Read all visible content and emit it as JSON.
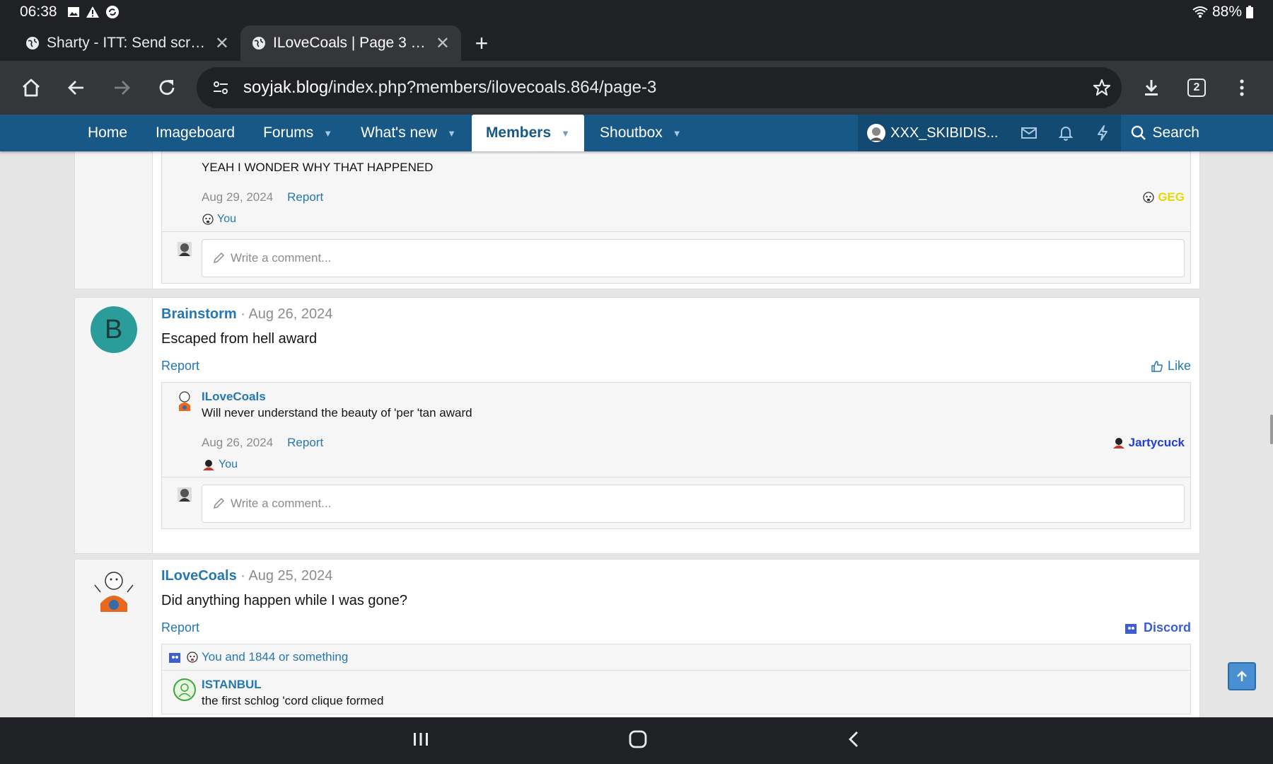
{
  "status_bar": {
    "time": "06:38",
    "battery": "88%"
  },
  "tabs": [
    {
      "title": "Sharty - ITT: Send screen",
      "active": false
    },
    {
      "title": "ILoveCoals | Page 3 | soyjak.blog",
      "active": true
    }
  ],
  "toolbar": {
    "tab_count": "2"
  },
  "omnibox": {
    "url_domain": "soyjak.blog",
    "url_path": "/index.php?members/ilovecoals.864/page-3"
  },
  "site_nav": {
    "items": [
      {
        "label": "Home",
        "caret": false
      },
      {
        "label": "Imageboard",
        "caret": false
      },
      {
        "label": "Forums",
        "caret": true
      },
      {
        "label": "What's new",
        "caret": true
      },
      {
        "label": "Members",
        "caret": true,
        "active": true
      },
      {
        "label": "Shoutbox",
        "caret": true
      }
    ],
    "user": "XXX_SKIBIDIS...",
    "search_label": "Search"
  },
  "post0": {
    "comment": {
      "text": "YEAH I WONDER WHY THAT HAPPENED",
      "date": "Aug 29, 2024",
      "report": "Report",
      "reaction": "GEG",
      "reaction_color": "#e6d800",
      "reacted_by": "You"
    },
    "comment_placeholder": "Write a comment..."
  },
  "post1": {
    "avatar_letter": "B",
    "avatar_color": "#2a9d9a",
    "author": "Brainstorm",
    "date": "Aug 26, 2024",
    "text": "Escaped from hell award",
    "report": "Report",
    "like": "Like",
    "comment": {
      "author": "ILoveCoals",
      "text": "Will never understand the beauty of 'per 'tan award",
      "date": "Aug 26, 2024",
      "report": "Report",
      "reaction": "Jartycuck",
      "reaction_color": "#1f3fd6",
      "reacted_by": "You"
    },
    "comment_placeholder": "Write a comment..."
  },
  "post2": {
    "author": "ILoveCoals",
    "date": "Aug 25, 2024",
    "text": "Did anything happen while I was gone?",
    "report": "Report",
    "reaction": "Discord",
    "reaction_color": "#3b5fcf",
    "reactions_summary": "You and 1844 or something",
    "comment": {
      "author": "ISTANBUL",
      "text": "the first schlog 'cord clique formed"
    }
  },
  "colors": {
    "nav_bg": "#185886",
    "link": "#2577b1"
  }
}
